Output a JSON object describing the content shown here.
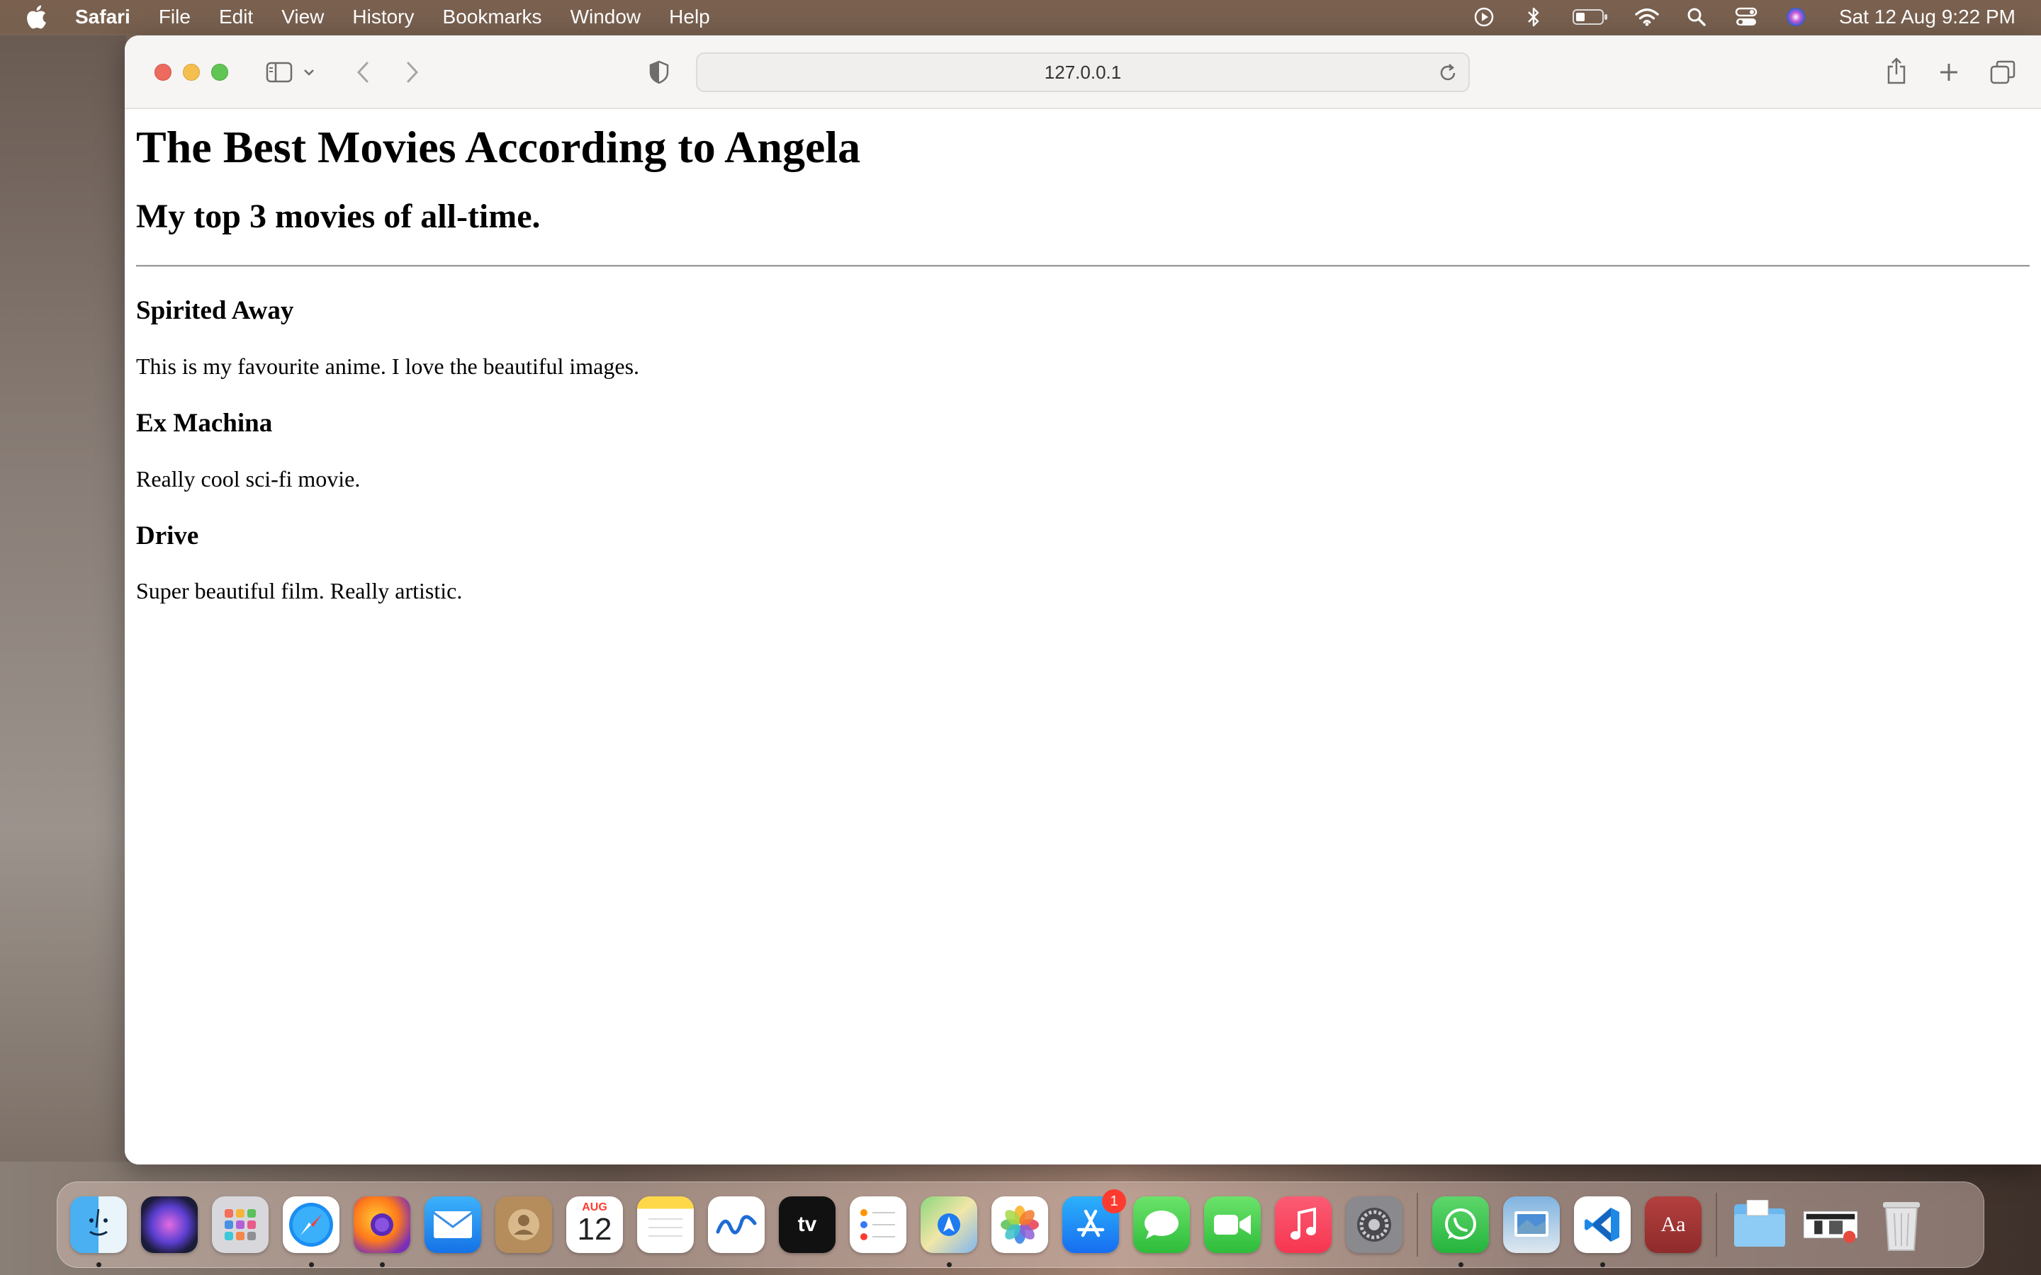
{
  "menubar": {
    "app_name": "Safari",
    "items": [
      "File",
      "Edit",
      "View",
      "History",
      "Bookmarks",
      "Window",
      "Help"
    ],
    "clock": "Sat 12 Aug  9:22 PM"
  },
  "browser": {
    "url": "127.0.0.1"
  },
  "page": {
    "title": "The Best Movies According to Angela",
    "subtitle": "My top 3 movies of all-time.",
    "movies": [
      {
        "name": "Spirited Away",
        "description": "This is my favourite anime. I love the beautiful images."
      },
      {
        "name": "Ex Machina",
        "description": "Really cool sci-fi movie."
      },
      {
        "name": "Drive",
        "description": "Super beautiful film. Really artistic."
      }
    ]
  },
  "dock": {
    "calendar_month": "AUG",
    "calendar_day": "12",
    "appstore_badge": "1",
    "appletv_label": "tv",
    "dictionary_label": "Aa"
  }
}
